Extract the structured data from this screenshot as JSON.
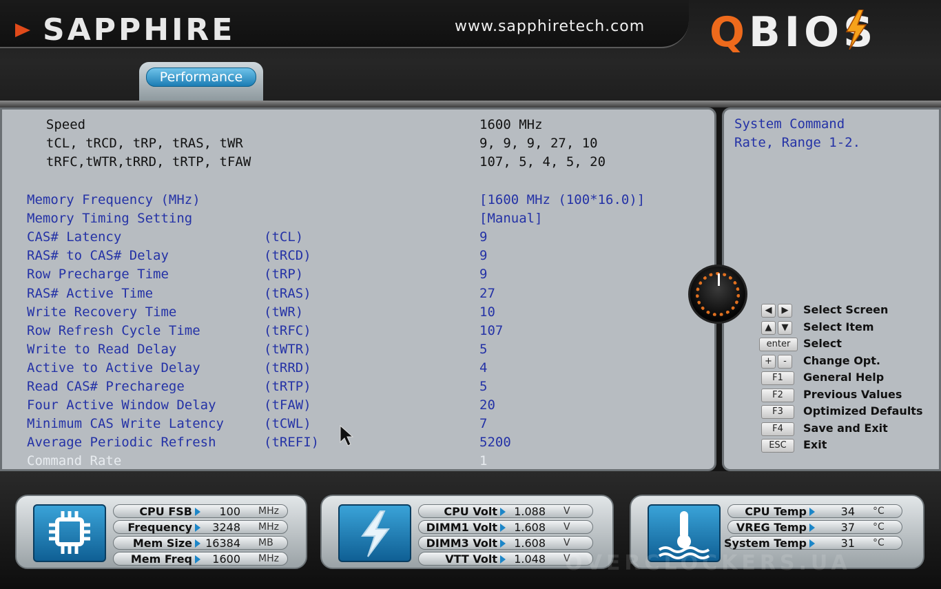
{
  "header": {
    "brand": "SAPPHIRE",
    "url": "www.sapphiretech.com",
    "product_q": "Q",
    "product_rest": "BIOS"
  },
  "tabs": [
    {
      "label": "Performance",
      "active": true
    }
  ],
  "info_rows": [
    {
      "label": "  Speed",
      "value": "1600 MHz"
    },
    {
      "label": "  tCL, tRCD, tRP, tRAS, tWR",
      "value": "9, 9, 9, 27, 10"
    },
    {
      "label": "  tRFC,tWTR,tRRD, tRTP, tFAW",
      "value": "107, 5, 4, 5, 20"
    }
  ],
  "settings": [
    {
      "label": "Memory Frequency (MHz)",
      "abbr": "",
      "value": "[1600 MHz (100*16.0)]"
    },
    {
      "label": "Memory Timing Setting",
      "abbr": "",
      "value": "[Manual]"
    },
    {
      "label": "CAS# Latency",
      "abbr": "(tCL)",
      "value": "9"
    },
    {
      "label": "RAS# to CAS# Delay",
      "abbr": "(tRCD)",
      "value": "9"
    },
    {
      "label": "Row Precharge Time",
      "abbr": "(tRP)",
      "value": "9"
    },
    {
      "label": "RAS# Active Time",
      "abbr": "(tRAS)",
      "value": "27"
    },
    {
      "label": "Write Recovery Time",
      "abbr": "(tWR)",
      "value": "10"
    },
    {
      "label": "Row Refresh Cycle Time",
      "abbr": "(tRFC)",
      "value": "107"
    },
    {
      "label": "Write to Read Delay",
      "abbr": "(tWTR)",
      "value": "5"
    },
    {
      "label": "Active to Active Delay",
      "abbr": "(tRRD)",
      "value": "4"
    },
    {
      "label": "Read CAS# Precharege",
      "abbr": "(tRTP)",
      "value": "5"
    },
    {
      "label": "Four Active Window Delay",
      "abbr": "(tFAW)",
      "value": "20"
    },
    {
      "label": "Minimum CAS Write Latency",
      "abbr": "(tCWL)",
      "value": "7"
    },
    {
      "label": "Average Periodic Refresh",
      "abbr": "(tREFI)",
      "value": "5200"
    },
    {
      "label": "Command Rate",
      "abbr": "",
      "value": "1",
      "selected": true
    }
  ],
  "help": {
    "line1": "System Command",
    "line2": "Rate, Range 1-2."
  },
  "keys": [
    {
      "keys": [
        "◀",
        "▶"
      ],
      "label": "Select Screen"
    },
    {
      "keys": [
        "▲",
        "▼"
      ],
      "label": "Select Item"
    },
    {
      "keys": [
        "enter"
      ],
      "label": "Select"
    },
    {
      "keys": [
        "+",
        "-"
      ],
      "label": "Change Opt."
    },
    {
      "keys": [
        "F1"
      ],
      "label": "General Help"
    },
    {
      "keys": [
        "F2"
      ],
      "label": "Previous Values"
    },
    {
      "keys": [
        "F3"
      ],
      "label": "Optimized Defaults"
    },
    {
      "keys": [
        "F4"
      ],
      "label": "Save and Exit"
    },
    {
      "keys": [
        "ESC"
      ],
      "label": "Exit"
    }
  ],
  "monitors": [
    {
      "icon": "cpu-chip-icon",
      "rows": [
        {
          "label": "CPU FSB",
          "value": "100",
          "unit": "MHz"
        },
        {
          "label": "Frequency",
          "value": "3248",
          "unit": "MHz"
        },
        {
          "label": "Mem Size",
          "value": "16384",
          "unit": "MB"
        },
        {
          "label": "Mem Freq",
          "value": "1600",
          "unit": "MHz"
        }
      ]
    },
    {
      "icon": "lightning-bolt-icon",
      "rows": [
        {
          "label": "CPU Volt",
          "value": "1.088",
          "unit": "V"
        },
        {
          "label": "DIMM1 Volt",
          "value": "1.608",
          "unit": "V"
        },
        {
          "label": "DIMM3 Volt",
          "value": "1.608",
          "unit": "V"
        },
        {
          "label": "VTT Volt",
          "value": "1.048",
          "unit": "V"
        }
      ]
    },
    {
      "icon": "thermometer-icon",
      "rows": [
        {
          "label": "CPU Temp",
          "value": "34",
          "unit": "°C"
        },
        {
          "label": "VREG Temp",
          "value": "37",
          "unit": "°C"
        },
        {
          "label": "System Temp",
          "value": "31",
          "unit": "°C"
        }
      ]
    }
  ],
  "watermark": "OVERCLOCKERS.UA",
  "colors": {
    "accent": "#ee6a1c",
    "item_text": "#2432a6",
    "panel_bg": "#b7bcc1",
    "monitor_icon": "#1c86c8"
  }
}
